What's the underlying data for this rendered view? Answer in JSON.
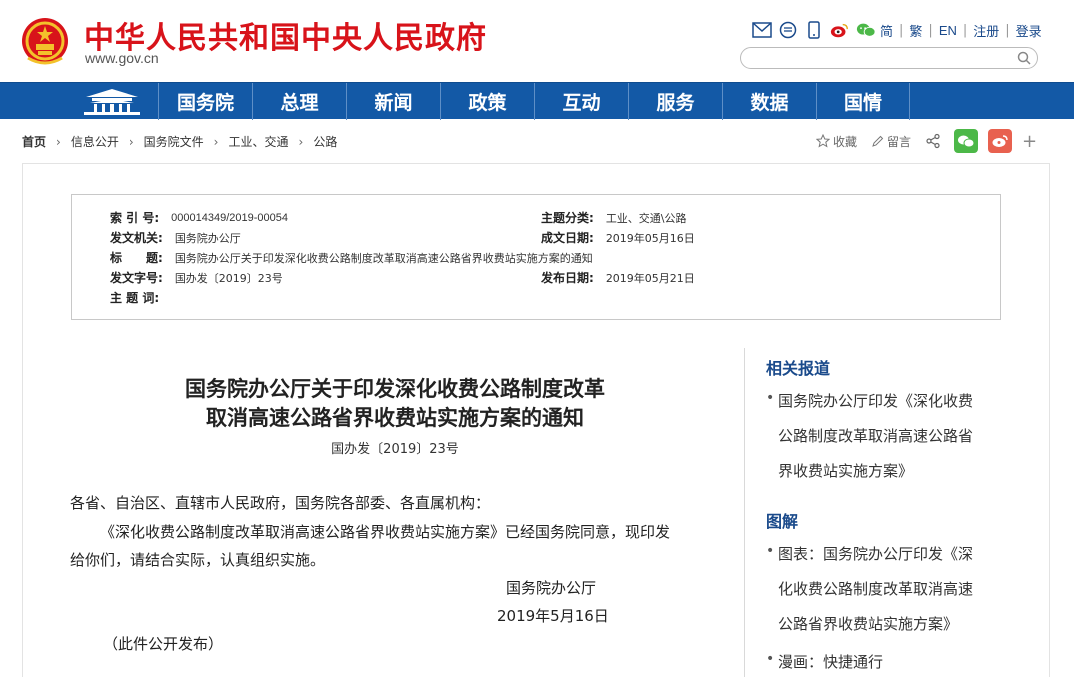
{
  "site": {
    "title": "中华人民共和国中央人民政府",
    "url": "www.gov.cn"
  },
  "top_links": {
    "jian": "简",
    "fan": "繁",
    "en": "EN",
    "register": "注册",
    "login": "登录"
  },
  "search": {
    "placeholder": ""
  },
  "nav": {
    "items": [
      "国务院",
      "总理",
      "新闻",
      "政策",
      "互动",
      "服务",
      "数据",
      "国情"
    ]
  },
  "breadcrumb": {
    "items": [
      "首页",
      "信息公开",
      "国务院文件",
      "工业、交通",
      "公路"
    ]
  },
  "actions": {
    "favorite": "收藏",
    "comment": "留言"
  },
  "info": {
    "index_label": "索 引 号:",
    "index_value": "000014349/2019-00054",
    "category_label": "主题分类:",
    "category_value": "工业、交通\\公路",
    "issuer_label": "发文机关:",
    "issuer_value": "国务院办公厅",
    "created_label": "成文日期:",
    "created_value": "2019年05月16日",
    "title_label": "标　　题:",
    "title_value": "国务院办公厅关于印发深化收费公路制度改革取消高速公路省界收费站实施方案的通知",
    "docno_label": "发文字号:",
    "docno_value": "国办发〔2019〕23号",
    "published_label": "发布日期:",
    "published_value": "2019年05月21日",
    "keywords_label": "主 题 词:",
    "keywords_value": ""
  },
  "article": {
    "title_line1": "国务院办公厅关于印发深化收费公路制度改革",
    "title_line2": "取消高速公路省界收费站实施方案的通知",
    "doc_number": "国办发〔2019〕23号",
    "salutation": "各省、自治区、直辖市人民政府，国务院各部委、各直属机构：",
    "para1_line1": "《深化收费公路制度改革取消高速公路省界收费站实施方案》已经国务院同意，现印发",
    "para1_line2": "给你们，请结合实际，认真组织实施。",
    "signature": "国务院办公厅",
    "date": "2019年5月16日",
    "note": "（此件公开发布）"
  },
  "sidebar": {
    "related_heading": "相关报道",
    "related_item_lines": [
      "国务院办公厅印发《深化收费",
      "公路制度改革取消高速公路省",
      "界收费站实施方案》"
    ],
    "graphic_heading": "图解",
    "graphic_item_lines": [
      "图表：国务院办公厅印发《深",
      "化收费公路制度改革取消高速",
      "公路省界收费站实施方案》"
    ],
    "comic_item": "漫画：快捷通行"
  },
  "colors": {
    "brand_red": "#d8131a",
    "nav_blue": "#1359a6",
    "link_blue": "#1a4a8b",
    "wechat_green": "#4cb848",
    "weibo_red": "#e8614f"
  }
}
